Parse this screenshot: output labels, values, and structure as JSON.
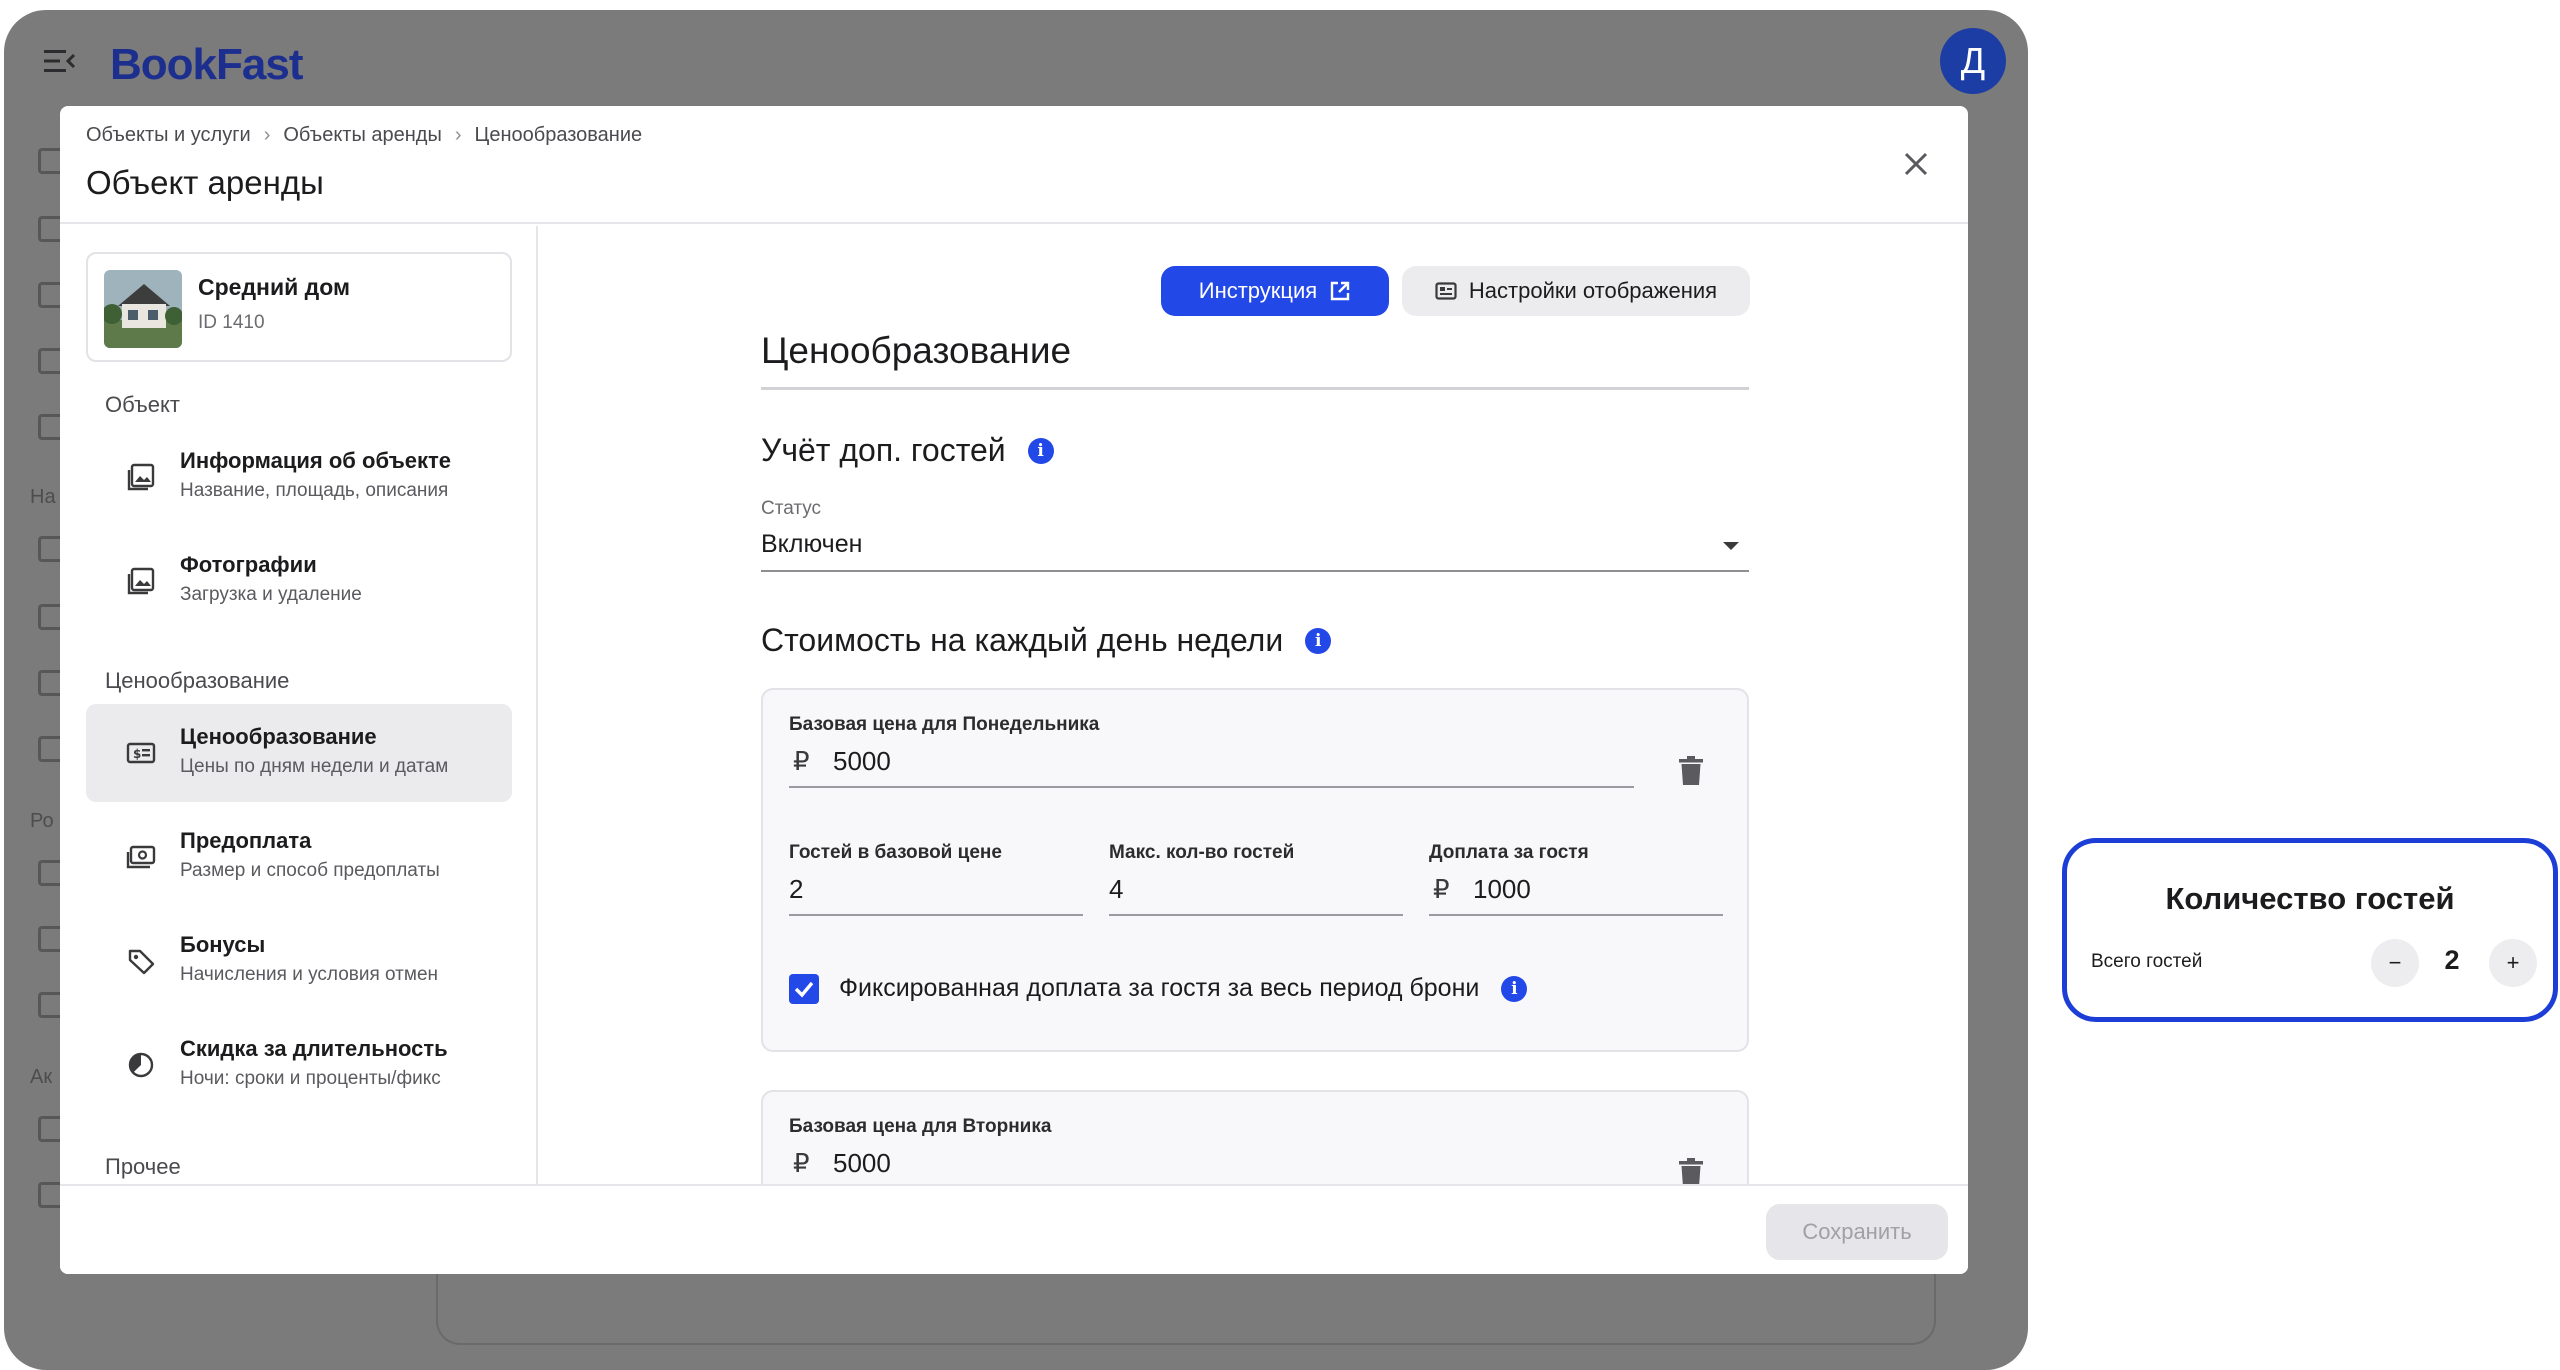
{
  "app": {
    "logo": "BookFast",
    "avatar_letter": "Д",
    "rail_labels": [
      "На",
      "Ро",
      "Ак"
    ]
  },
  "modal": {
    "breadcrumb": [
      "Объекты и услуги",
      "Объекты аренды",
      "Ценообразование"
    ],
    "title": "Объект аренды"
  },
  "object": {
    "name": "Средний дом",
    "id": "ID 1410"
  },
  "nav": {
    "section_object": "Объект",
    "section_pricing": "Ценообразование",
    "section_other": "Прочее",
    "items": [
      {
        "title": "Информация об объекте",
        "sub": "Название, площадь, описания"
      },
      {
        "title": "Фотографии",
        "sub": "Загрузка и удаление"
      },
      {
        "title": "Ценообразование",
        "sub": "Цены по дням недели и датам"
      },
      {
        "title": "Предоплата",
        "sub": "Размер и способ предоплаты"
      },
      {
        "title": "Бонусы",
        "sub": "Начисления и условия отмен"
      },
      {
        "title": "Скидка за длительность",
        "sub": "Ночи: сроки и проценты/фикс"
      }
    ]
  },
  "content": {
    "instruction_label": "Инструкция",
    "display_settings_label": "Настройки отображения",
    "page_heading": "Ценообразование",
    "extra_guests_heading": "Учёт доп. гостей",
    "status_label": "Статус",
    "status_value": "Включен",
    "weekday_heading": "Стоимость на каждый день недели",
    "currency": "₽",
    "monday": {
      "base_label": "Базовая цена для Понедельника",
      "base_value": "5000",
      "guests_in_base_label": "Гостей в базовой цене",
      "guests_in_base_value": "2",
      "max_guests_label": "Макс. кол-во гостей",
      "max_guests_value": "4",
      "extra_fee_label": "Доплата за гостя",
      "extra_fee_value": "1000",
      "fixed_fee_label": "Фиксированная доплата за гостя за весь период брони",
      "fixed_fee_checked": true
    },
    "tuesday": {
      "base_label": "Базовая цена для Вторника",
      "base_value": "5000"
    },
    "save_label": "Сохранить"
  },
  "guests_widget": {
    "title": "Количество гостей",
    "label": "Всего гостей",
    "value": "2",
    "minus": "−",
    "plus": "+"
  },
  "colors": {
    "accent": "#2348e8",
    "brand_dark": "#1c2f8f",
    "overlay": "#7b7b7b"
  }
}
